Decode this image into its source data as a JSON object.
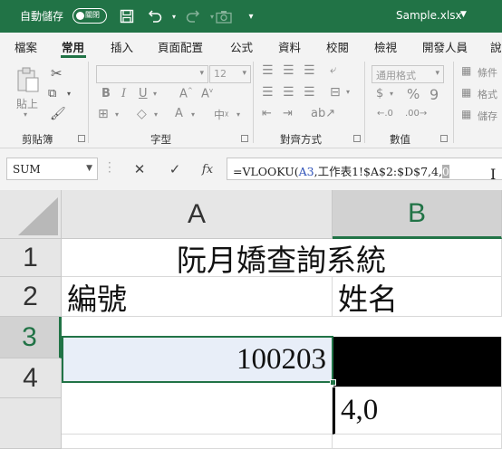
{
  "titlebar": {
    "autosave_label": "自動儲存",
    "autosave_state": "關閉",
    "filename": "Sample.xlsx"
  },
  "tabs": [
    "檔案",
    "常用",
    "插入",
    "頁面配置",
    "公式",
    "資料",
    "校閱",
    "檢視",
    "開發人員",
    "說"
  ],
  "active_tab": "常用",
  "ribbon": {
    "groups": {
      "clipboard": "剪貼簿",
      "font": "字型",
      "alignment": "對齊方式",
      "number": "數值"
    },
    "paste_label": "貼上",
    "font_size": "12",
    "number_format": "通用格式",
    "right_items": [
      "條件",
      "格式",
      "儲存"
    ]
  },
  "formula_bar": {
    "name_box": "SUM",
    "formula_prefix": "=VLOOKU(",
    "formula_ref": "A3",
    "formula_rest": ",工作表1!$A$2:$D$7,4,",
    "formula_cursor_char": "0"
  },
  "grid": {
    "columns": [
      "A",
      "B"
    ],
    "rows": [
      "1",
      "2",
      "3",
      "4"
    ],
    "cells": {
      "A1": "阮月嬌查詢系統",
      "A2": "編號",
      "B2": "姓名",
      "A3": "100203",
      "B3": "",
      "A4": "",
      "B4": "4,0"
    }
  },
  "colors": {
    "excel_green": "#217346",
    "reference_blue": "#2f52b8"
  }
}
